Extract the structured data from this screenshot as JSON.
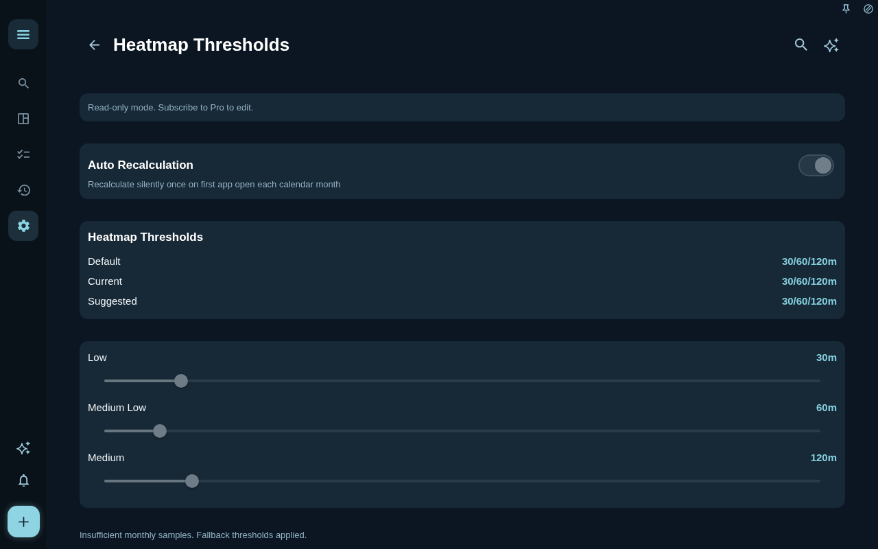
{
  "sidebar": {
    "items": [
      {
        "kind": "search",
        "selected": false
      },
      {
        "kind": "layout",
        "selected": false
      },
      {
        "kind": "checklist",
        "selected": false
      },
      {
        "kind": "history",
        "selected": false
      },
      {
        "kind": "settings",
        "selected": true
      }
    ]
  },
  "header": {
    "title": "Heatmap Thresholds"
  },
  "notice": "Read-only mode. Subscribe to Pro to edit.",
  "auto_recalculation": {
    "title": "Auto Recalculation",
    "description": "Recalculate silently once on first app open each calendar month",
    "toggle": {
      "on": true,
      "disabled": true
    }
  },
  "thresholds": {
    "title": "Heatmap Thresholds",
    "rows": [
      {
        "label": "Default",
        "value": "30/60/120m"
      },
      {
        "label": "Current",
        "value": "30/60/120m"
      },
      {
        "label": "Suggested",
        "value": "30/60/120m"
      }
    ]
  },
  "sliders": [
    {
      "label": "Low",
      "reading": "30m",
      "level": 0.107,
      "disabled": true
    },
    {
      "label": "Medium Low",
      "reading": "60m",
      "level": 0.078,
      "disabled": true
    },
    {
      "label": "Medium",
      "reading": "120m",
      "level": 0.123,
      "disabled": true
    }
  ],
  "footer_note": "Insufficient monthly samples. Fallback thresholds applied."
}
